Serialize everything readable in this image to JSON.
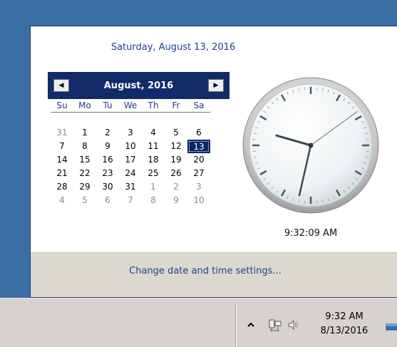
{
  "flyout": {
    "long_date": "Saturday, August 13, 2016",
    "calendar": {
      "month_title": "August, 2016",
      "weekdays": [
        "Su",
        "Mo",
        "Tu",
        "We",
        "Th",
        "Fr",
        "Sa"
      ],
      "weeks": [
        [
          {
            "d": "31",
            "other": true
          },
          {
            "d": "1"
          },
          {
            "d": "2"
          },
          {
            "d": "3"
          },
          {
            "d": "4"
          },
          {
            "d": "5"
          },
          {
            "d": "6"
          }
        ],
        [
          {
            "d": "7"
          },
          {
            "d": "8"
          },
          {
            "d": "9"
          },
          {
            "d": "10"
          },
          {
            "d": "11"
          },
          {
            "d": "12"
          },
          {
            "d": "13",
            "today": true
          }
        ],
        [
          {
            "d": "14"
          },
          {
            "d": "15"
          },
          {
            "d": "16"
          },
          {
            "d": "17"
          },
          {
            "d": "18"
          },
          {
            "d": "19"
          },
          {
            "d": "20"
          }
        ],
        [
          {
            "d": "21"
          },
          {
            "d": "22"
          },
          {
            "d": "23"
          },
          {
            "d": "24"
          },
          {
            "d": "25"
          },
          {
            "d": "26"
          },
          {
            "d": "27"
          }
        ],
        [
          {
            "d": "28"
          },
          {
            "d": "29"
          },
          {
            "d": "30"
          },
          {
            "d": "31"
          },
          {
            "d": "1",
            "other": true
          },
          {
            "d": "2",
            "other": true
          },
          {
            "d": "3",
            "other": true
          }
        ],
        [
          {
            "d": "4",
            "other": true
          },
          {
            "d": "5",
            "other": true
          },
          {
            "d": "6",
            "other": true
          },
          {
            "d": "7",
            "other": true
          },
          {
            "d": "8",
            "other": true
          },
          {
            "d": "9",
            "other": true
          },
          {
            "d": "10",
            "other": true
          }
        ]
      ]
    },
    "clock": {
      "digital": "9:32:09 AM",
      "hour": 9,
      "minute": 32,
      "second": 9
    },
    "change_link": "Change date and time settings..."
  },
  "taskbar": {
    "time": "9:32 AM",
    "date": "8/13/2016",
    "icons": [
      "show-hidden-icons-chevron-icon",
      "network-icon",
      "volume-icon",
      "show-desktop-icon"
    ]
  },
  "colors": {
    "desktop": "#3a6ea5",
    "calendar_header": "#102a6a",
    "link": "#1f3f8f",
    "footer": "#dcd8ce",
    "taskbar": "#d6d3ce"
  }
}
